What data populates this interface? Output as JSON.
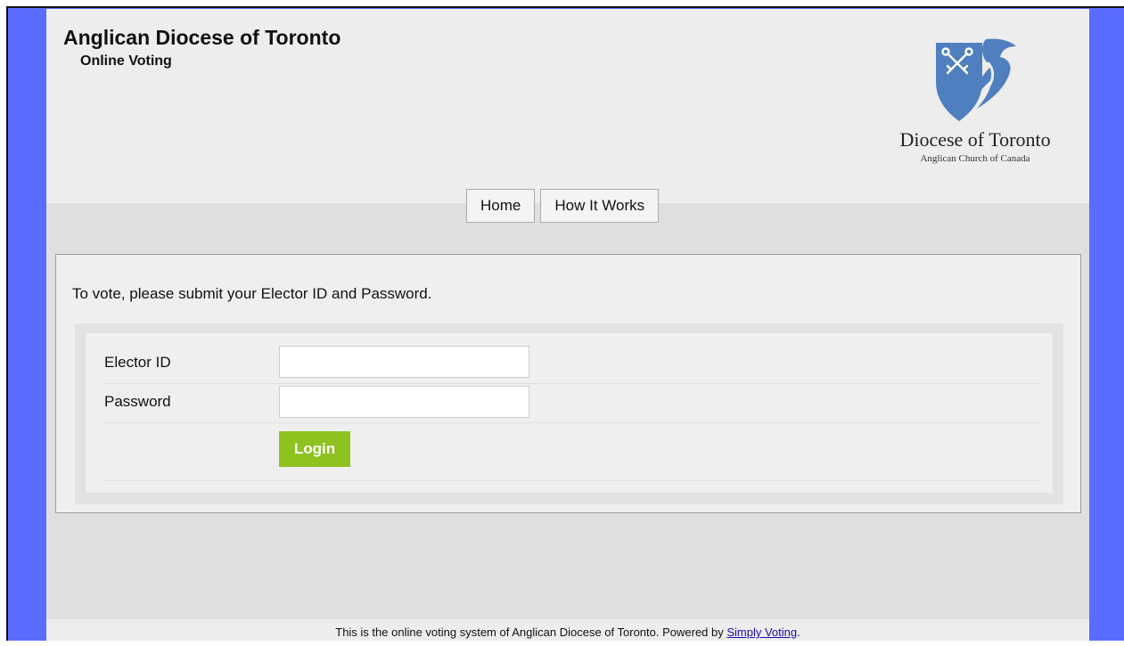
{
  "header": {
    "title": "Anglican Diocese of Toronto",
    "subtitle": "Online Voting",
    "logo": {
      "name": "Diocese of Toronto",
      "tagline": "Anglican Church of Canada",
      "icon": "diocese-shield-dove-icon",
      "color": "#4f7fbf"
    }
  },
  "nav": {
    "home_label": "Home",
    "how_it_works_label": "How It Works"
  },
  "login": {
    "instructions": "To vote, please submit your Elector ID and Password.",
    "elector_id_label": "Elector ID",
    "elector_id_value": "",
    "password_label": "Password",
    "password_value": "",
    "submit_label": "Login",
    "submit_color": "#8dc21f"
  },
  "footer": {
    "text_before": "This is the online voting system of Anglican Diocese of Toronto. Powered by ",
    "link_text": "Simply Voting",
    "text_after": "."
  },
  "colors": {
    "side_bars": "#5a6cff",
    "page_background": "#dfdfdf",
    "header_background": "#ededed"
  }
}
